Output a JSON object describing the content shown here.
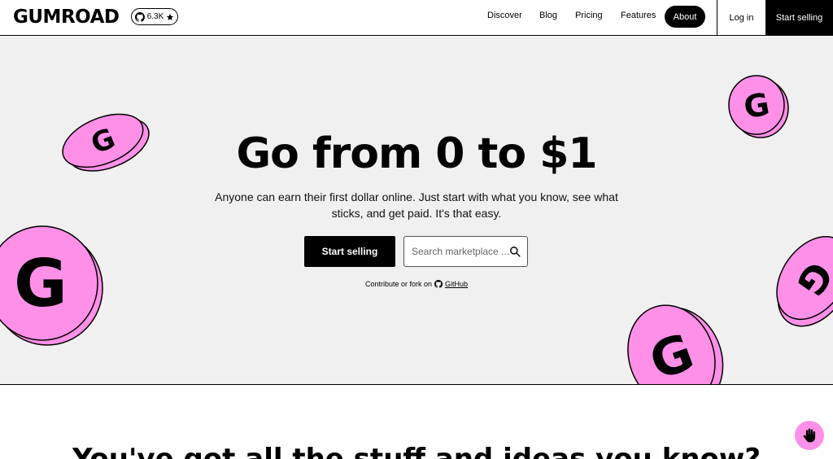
{
  "header": {
    "logo": "GUMROAD",
    "github_stars": "6.3K",
    "nav": {
      "discover": "Discover",
      "blog": "Blog",
      "pricing": "Pricing",
      "features": "Features",
      "about": "About"
    },
    "login": "Log in",
    "start_selling": "Start selling"
  },
  "hero": {
    "title": "Go from 0 to $1",
    "subtitle": "Anyone can earn their first dollar online. Just start with what you know, see what sticks, and get paid. It's that easy.",
    "cta": "Start selling",
    "search_placeholder": "Search marketplace ...",
    "contribute_text": "Contribute or fork on",
    "github_link": "GitHub"
  },
  "section2": {
    "title": "You've got all the stuff and ideas you know?"
  },
  "colors": {
    "accent_pink": "#ff90e8",
    "hero_bg": "#f0f0f0",
    "black": "#000000"
  },
  "icons": [
    "github-icon",
    "star-icon",
    "search-icon",
    "chat-hand-icon",
    "gumroad-coin-icon"
  ]
}
